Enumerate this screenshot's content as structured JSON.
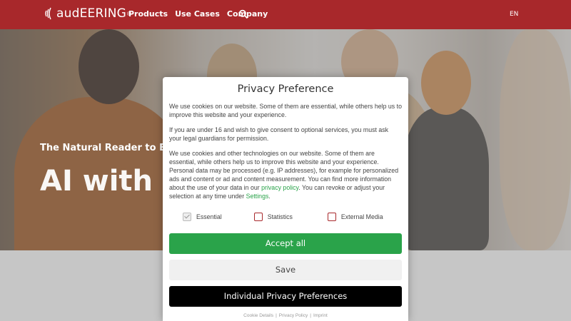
{
  "header": {
    "brand": "audEERING",
    "brand_mark": "®",
    "nav": [
      "Products",
      "Use Cases",
      "Company"
    ],
    "language": "EN",
    "color": "#a8282b"
  },
  "hero": {
    "subtitle": "The Natural Reader to Enhanc",
    "title": "AI with Em"
  },
  "modal": {
    "title": "Privacy Preference",
    "para1": "We use cookies on our website. Some of them are essential, while others help us to improve this website and your experience.",
    "para2": "If you are under 16 and wish to give consent to optional services, you must ask your legal guardians for permission.",
    "para3_a": "We use cookies and other technologies on our website. Some of them are essential, while others help us to improve this website and your experience. Personal data may be processed (e.g. IP addresses), for example for personalized ads and content or ad and content measurement. You can find more information about the use of your data in our ",
    "para3_link": "privacy policy",
    "para3_b": ". You can revoke or adjust your selection at any time under ",
    "para3_settings": "Settings",
    "para3_end": ".",
    "checkboxes": [
      {
        "label": "Essential",
        "checked": true,
        "disabled": true
      },
      {
        "label": "Statistics",
        "checked": false,
        "disabled": false
      },
      {
        "label": "External Media",
        "checked": false,
        "disabled": false
      }
    ],
    "accept_label": "Accept all",
    "save_label": "Save",
    "individual_label": "Individual Privacy Preferences",
    "footer": {
      "cookie_details": "Cookie Details",
      "privacy_policy": "Privacy Policy",
      "imprint": "Imprint",
      "separator": "|"
    },
    "accent_color": "#2aa34a"
  }
}
